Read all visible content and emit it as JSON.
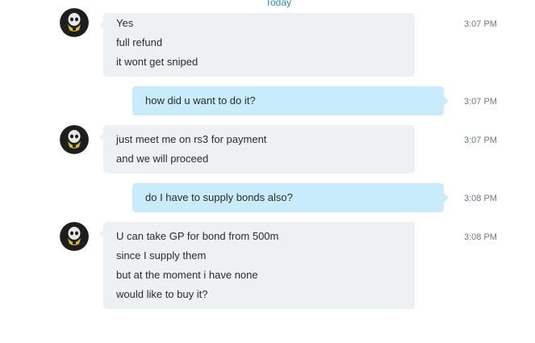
{
  "chat": {
    "day_label": "Today",
    "messages": [
      {
        "direction": "incoming",
        "lines": [
          "Yes",
          "full refund",
          "it wont get sniped"
        ],
        "time": "3:07 PM"
      },
      {
        "direction": "outgoing",
        "lines": [
          "how did u want to do it?"
        ],
        "time": "3:07 PM"
      },
      {
        "direction": "incoming",
        "lines": [
          "just meet me on rs3 for payment",
          "and we will proceed"
        ],
        "time": "3:07 PM"
      },
      {
        "direction": "outgoing",
        "lines": [
          "do I have to supply bonds also?"
        ],
        "time": "3:08 PM"
      },
      {
        "direction": "incoming",
        "lines": [
          "U can take GP for bond from 500m",
          "since I supply them",
          "but at the moment i have none",
          "would like to buy it?"
        ],
        "time": "3:08 PM"
      }
    ],
    "avatar_icon": "skull-gasmask-icon",
    "colors": {
      "incoming_bubble": "#eef1f4",
      "outgoing_bubble": "#c8ecfb",
      "day_label": "#2d87c5",
      "timestamp": "#6b7785"
    }
  }
}
